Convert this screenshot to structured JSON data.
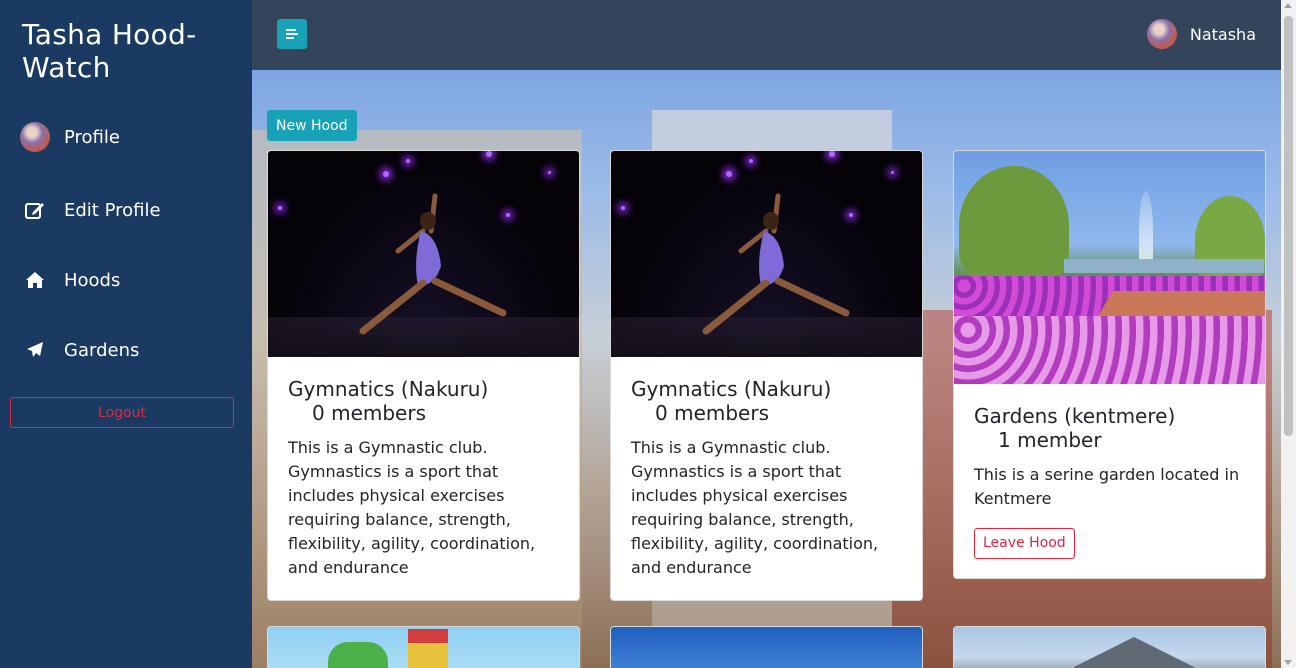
{
  "sidebar": {
    "brand": "Tasha Hood-Watch",
    "items": [
      {
        "label": "Profile",
        "icon": "avatar"
      },
      {
        "label": "Edit Profile",
        "icon": "edit-icon"
      },
      {
        "label": "Hoods",
        "icon": "home-icon"
      },
      {
        "label": "Gardens",
        "icon": "paper-plane-icon"
      }
    ],
    "logout_label": "Logout"
  },
  "topbar": {
    "user_name": "Natasha"
  },
  "main": {
    "new_hood_label": "New Hood",
    "cards": [
      {
        "title": "Gymnatics (Nakuru)",
        "members": "0 members",
        "description": "This is a Gymnastic club. Gymnastics is a sport that includes physical exercises requiring balance, strength, flexibility, agility, coordination, and endurance"
      },
      {
        "title": "Gymnatics (Nakuru)",
        "members": "0 members",
        "description": "This is a Gymnastic club. Gymnastics is a sport that includes physical exercises requiring balance, strength, flexibility, agility, coordination, and endurance"
      },
      {
        "title": "Gardens (kentmere)",
        "members": "1 member",
        "description": "This is a serine garden located in Kentmere",
        "action_label": "Leave Hood"
      }
    ]
  },
  "colors": {
    "sidebar_bg": "#1b3a61",
    "topbar_bg": "#34445a",
    "accent": "#17a2b8",
    "danger": "#d62a44"
  }
}
